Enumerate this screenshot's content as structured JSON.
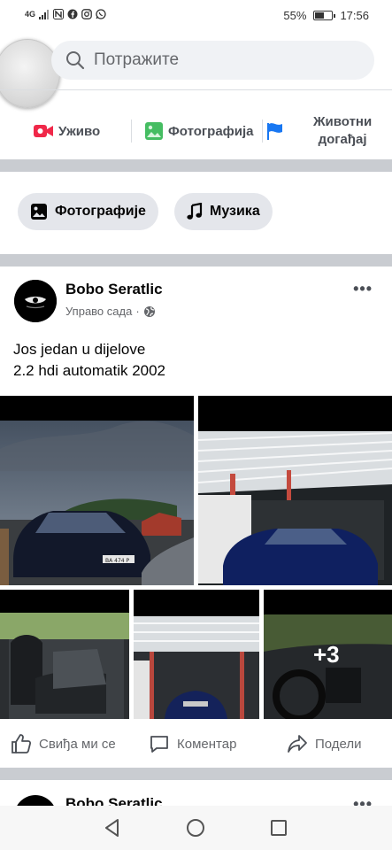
{
  "status_bar": {
    "network": "4G",
    "battery": "55%",
    "battery_level": 0.55,
    "time": "17:56"
  },
  "search": {
    "placeholder": "Потражите"
  },
  "actions": {
    "live": "Уживо",
    "photo": "Фотографија",
    "life_event_line1": "Животни",
    "life_event_line2": "догађај"
  },
  "chips": {
    "photos": "Фотографије",
    "music": "Музика"
  },
  "post": {
    "author": "Bobo Seratlic",
    "time": "Управо сада",
    "text_line1": "Jos jedan u dijelove",
    "text_line2": "2.2 hdi automatik 2002",
    "more_photos": "+3",
    "plate": "BA 474 P"
  },
  "reactions": {
    "like": "Свиђа ми се",
    "comment": "Коментар",
    "share": "Подели"
  },
  "next_post": {
    "author": "Bobo Seratlic"
  },
  "icons": {
    "search": "search-icon",
    "live": "live-video-icon",
    "photo": "photo-icon",
    "flag": "flag-icon",
    "music": "music-note-icon",
    "globe": "globe-icon",
    "like": "thumbs-up-icon",
    "comment": "comment-icon",
    "share": "share-icon"
  },
  "colors": {
    "live_red": "#f02849",
    "photo_green": "#45bd62",
    "flag_blue": "#1877f2",
    "separator_gray": "#c9ccd1"
  }
}
